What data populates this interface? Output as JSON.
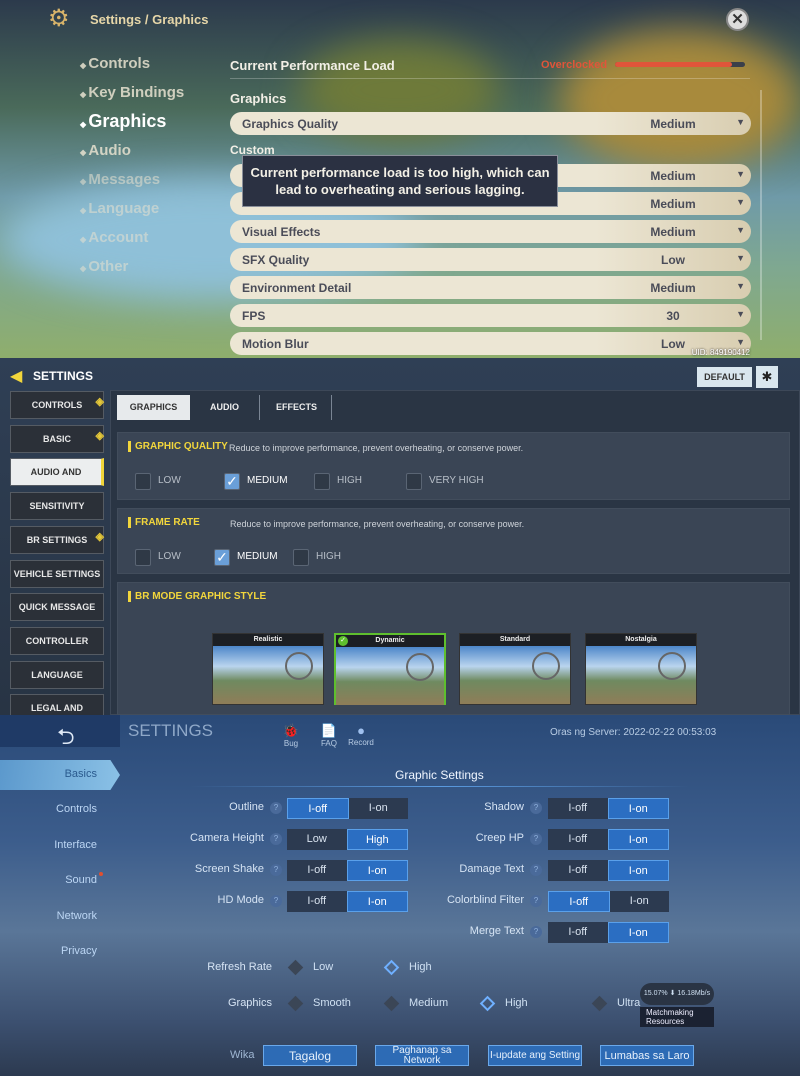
{
  "genshin": {
    "breadcrumb": "Settings / Graphics",
    "nav": [
      "Controls",
      "Key Bindings",
      "Graphics",
      "Audio",
      "Messages",
      "Language",
      "Account",
      "Other"
    ],
    "selected_nav": "Graphics",
    "perf_label": "Current Performance Load",
    "perf_status": "Overclocked",
    "perf_load_percent": 90,
    "perf_color": "#e0553a",
    "section": "Graphics",
    "custom_label": "Custom",
    "rows": [
      {
        "label": "Graphics Quality",
        "value": "Medium"
      },
      {
        "label": "",
        "value": "Medium"
      },
      {
        "label": "",
        "value": "Medium"
      },
      {
        "label": "Visual Effects",
        "value": "Medium"
      },
      {
        "label": "SFX Quality",
        "value": "Low"
      },
      {
        "label": "Environment Detail",
        "value": "Medium"
      },
      {
        "label": "FPS",
        "value": "30"
      },
      {
        "label": "Motion Blur",
        "value": "Low"
      }
    ],
    "tooltip": "Current performance load is too high, which can lead to overheating and serious lagging.",
    "uid": "UID: 849190412"
  },
  "codm": {
    "title": "SETTINGS",
    "default_button": "DEFAULT",
    "sidebar": [
      {
        "label": "CONTROLS",
        "warn": true
      },
      {
        "label": "BASIC",
        "warn": true
      },
      {
        "label": "AUDIO AND GRAPHICS",
        "warn": false
      },
      {
        "label": "SENSITIVITY",
        "warn": false
      },
      {
        "label": "BR SETTINGS",
        "warn": true
      },
      {
        "label": "VEHICLE SETTINGS",
        "warn": false
      },
      {
        "label": "QUICK MESSAGE",
        "warn": false
      },
      {
        "label": "CONTROLLER",
        "warn": false
      },
      {
        "label": "LANGUAGE",
        "warn": false
      },
      {
        "label": "LEGAL AND PRIVACY",
        "warn": false
      }
    ],
    "selected_sidebar": "AUDIO AND GRAPHICS",
    "tabs": [
      "GRAPHICS",
      "AUDIO",
      "EFFECTS"
    ],
    "selected_tab": "GRAPHICS",
    "graphic_quality": {
      "title": "GRAPHIC QUALITY",
      "desc": "Reduce to improve performance, prevent overheating, or conserve power.",
      "options": [
        "LOW",
        "MEDIUM",
        "HIGH",
        "VERY HIGH"
      ],
      "selected": "MEDIUM"
    },
    "frame_rate": {
      "title": "FRAME RATE",
      "desc": "Reduce to improve performance, prevent overheating, or conserve power.",
      "options": [
        "LOW",
        "MEDIUM",
        "HIGH"
      ],
      "selected": "MEDIUM"
    },
    "br_style": {
      "title": "BR MODE GRAPHIC STYLE",
      "options": [
        "Realistic",
        "Dynamic",
        "Standard",
        "Nostalgia"
      ],
      "selected": "Dynamic"
    },
    "accent": "#f2d63c"
  },
  "mlbb": {
    "title": "SETTINGS",
    "header_icons": [
      "Bug",
      "FAQ",
      "Record"
    ],
    "server_time": "Oras ng Server: 2022-02-22 00:53:03",
    "nav": [
      "Basics",
      "Controls",
      "Interface",
      "Sound",
      "Network",
      "Privacy"
    ],
    "selected_nav": "Basics",
    "section_title": "Graphic Settings",
    "left_toggles": [
      {
        "label": "Outline",
        "options": [
          "I-off",
          "I-on"
        ],
        "selected": 0
      },
      {
        "label": "Camera Height",
        "options": [
          "Low",
          "High"
        ],
        "selected": 1
      },
      {
        "label": "Screen Shake",
        "options": [
          "I-off",
          "I-on"
        ],
        "selected": 1
      },
      {
        "label": "HD Mode",
        "options": [
          "I-off",
          "I-on"
        ],
        "selected": 1
      }
    ],
    "right_toggles": [
      {
        "label": "Shadow",
        "options": [
          "I-off",
          "I-on"
        ],
        "selected": 1
      },
      {
        "label": "Creep HP",
        "options": [
          "I-off",
          "I-on"
        ],
        "selected": 1
      },
      {
        "label": "Damage Text",
        "options": [
          "I-off",
          "I-on"
        ],
        "selected": 1
      },
      {
        "label": "Colorblind Filter",
        "options": [
          "I-off",
          "I-on"
        ],
        "selected": 0
      },
      {
        "label": "Merge Text",
        "options": [
          "I-off",
          "I-on"
        ],
        "selected": 1
      }
    ],
    "refresh_rate": {
      "label": "Refresh Rate",
      "options": [
        "Low",
        "High"
      ],
      "selected": "High"
    },
    "graphics": {
      "label": "Graphics",
      "options": [
        "Smooth",
        "Medium",
        "High",
        "Ultra"
      ],
      "selected": "High"
    },
    "net_percent": "15.07%",
    "net_speed": "16.18Mb/s",
    "net_label": "Matchmaking Resources",
    "language_label": "Wika",
    "buttons": [
      "Tagalog",
      "Paghanap sa Network",
      "I-update ang Setting",
      "Lumabas sa Laro"
    ]
  }
}
